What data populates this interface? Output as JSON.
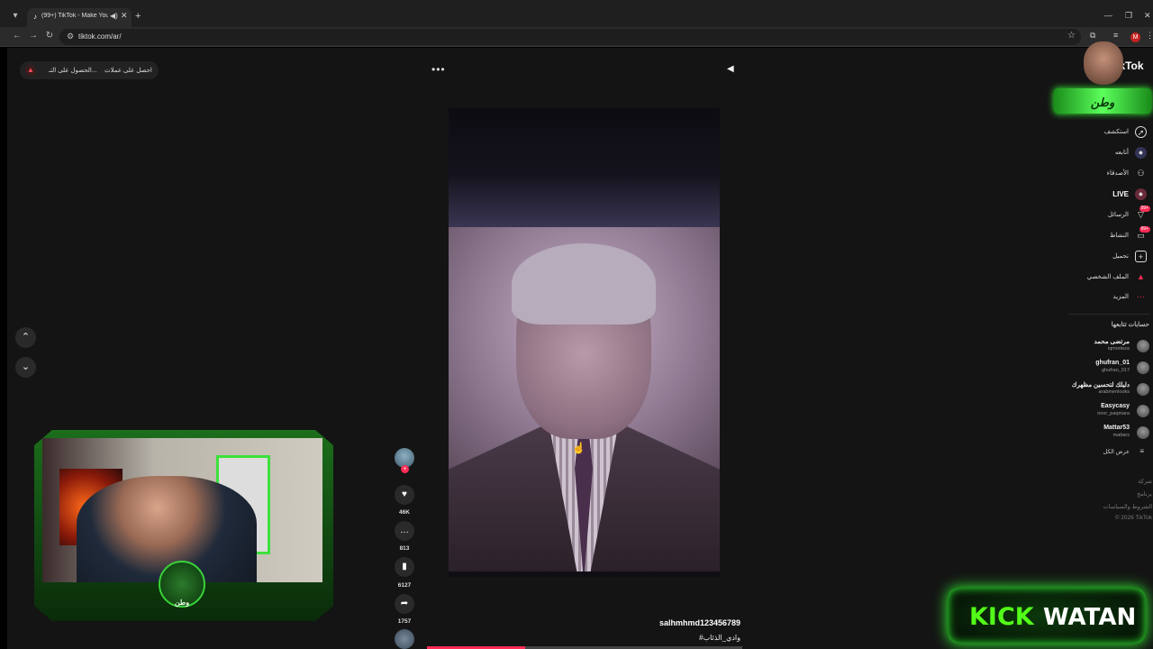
{
  "browser": {
    "tab_title": "(99+) TikTok - Make Your D...",
    "url": "tiktok.com/ar/"
  },
  "top_bar": {
    "item1": "احصل على عملات",
    "item2": "الحصول على التـ..."
  },
  "video": {
    "author": "salhmhmd123456789",
    "hashtag": "#وادي_الذئاب",
    "progress_fraction": 0.31
  },
  "actions": {
    "likes": "46K",
    "comments": "813",
    "saves": "6127",
    "shares": "1757"
  },
  "webcam": {
    "badge_text": "وطن"
  },
  "sidebar": {
    "logo": "TikTok",
    "streamer_text": "وطن",
    "nav": [
      {
        "label": "استكشف",
        "icon": "compass-icon"
      },
      {
        "label": "أتابعه",
        "icon": "following-icon"
      },
      {
        "label": "الأصدقاء",
        "icon": "friends-icon"
      },
      {
        "label": "LIVE",
        "icon": "live-icon"
      },
      {
        "label": "الرسائل",
        "icon": "messages-icon",
        "badge": "99+"
      },
      {
        "label": "النشاط",
        "icon": "activity-icon",
        "badge": "99+"
      },
      {
        "label": "تحميل",
        "icon": "upload-icon"
      },
      {
        "label": "الملف الشخصي",
        "icon": "profile-icon"
      },
      {
        "label": "المزيد",
        "icon": "more-icon"
      }
    ],
    "following_heading": "حسابات تتابعها",
    "accounts": [
      {
        "name": "مرتضى محمد",
        "handle": "iqmorteza"
      },
      {
        "name": "ghufran_01",
        "handle": "ghufran_017"
      },
      {
        "name": "دليلك لتحسين مظهرك",
        "handle": "arabmenlooks"
      },
      {
        "name": "Easycasy",
        "handle": "noor_paqmara"
      },
      {
        "name": "Mattar53",
        "handle": "mattarx"
      }
    ],
    "see_all": "عرض الكل",
    "footer": [
      "شركة",
      "برنامج",
      "الشروط والسياسات",
      "© 2026 TikTok"
    ]
  },
  "overlay": {
    "kick": "KICK",
    "watan": "WATAN"
  },
  "colors": {
    "accent": "#fe2c55",
    "kick_green": "#53fc18"
  }
}
